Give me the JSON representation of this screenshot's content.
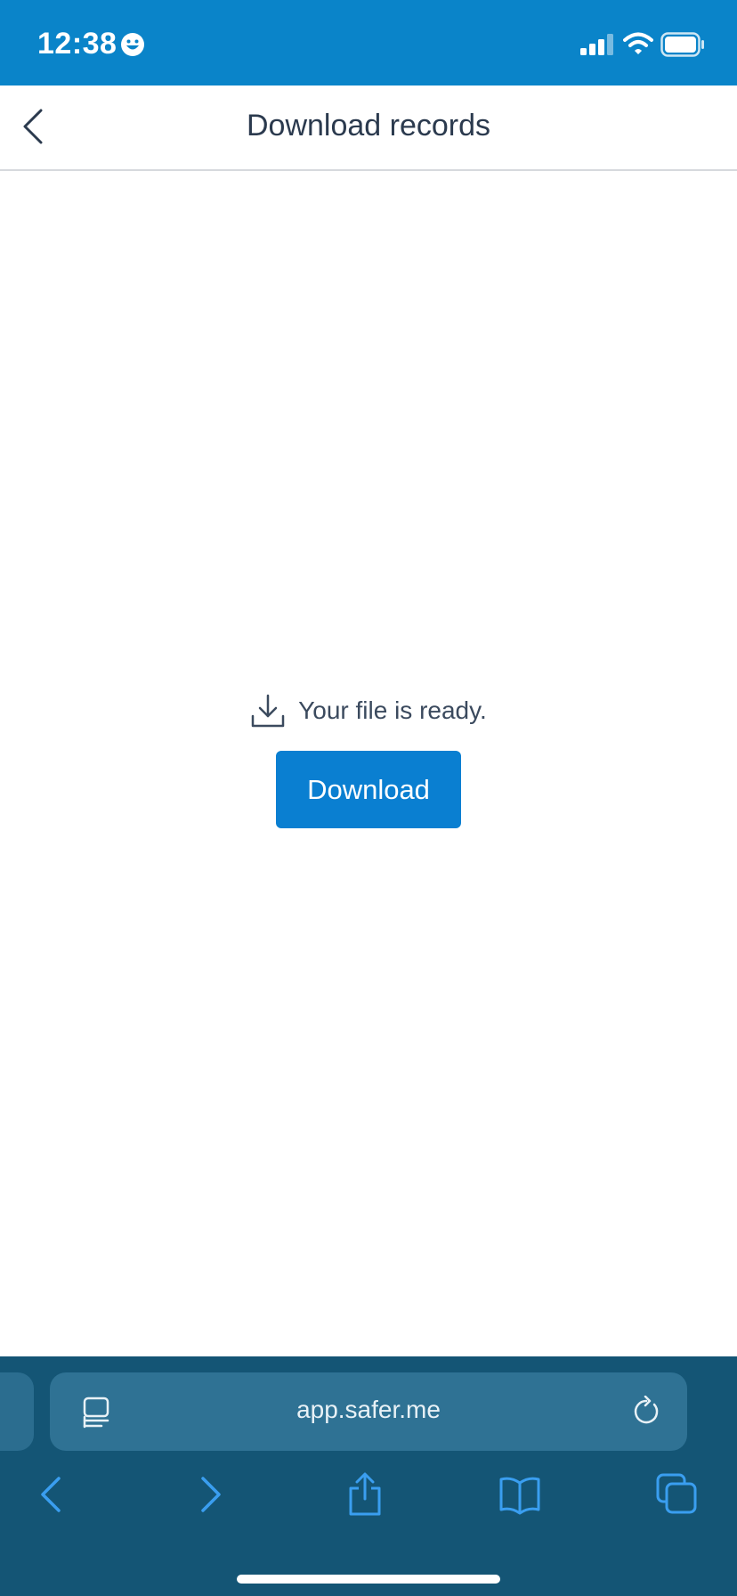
{
  "status_bar": {
    "time": "12:38",
    "icons": [
      "emoji-icon",
      "cellular-signal-icon",
      "wifi-icon",
      "battery-icon"
    ]
  },
  "header": {
    "title": "Download records",
    "back_icon": "chevron-left-icon"
  },
  "main": {
    "ready_icon": "download-icon",
    "ready_text": "Your file is ready.",
    "download_button_label": "Download"
  },
  "browser": {
    "url": "app.safer.me",
    "toolbar_icons": [
      "back-icon",
      "forward-icon",
      "share-icon",
      "bookmarks-icon",
      "tabs-icon"
    ]
  },
  "colors": {
    "status_bar_bg": "#0a84c9",
    "primary_button": "#0a7fd1",
    "browser_bar_bg": "#145575",
    "address_bar_bg": "#2f7294",
    "title_text": "#2b3a4e",
    "toolbar_icon": "#3a9ef0"
  }
}
